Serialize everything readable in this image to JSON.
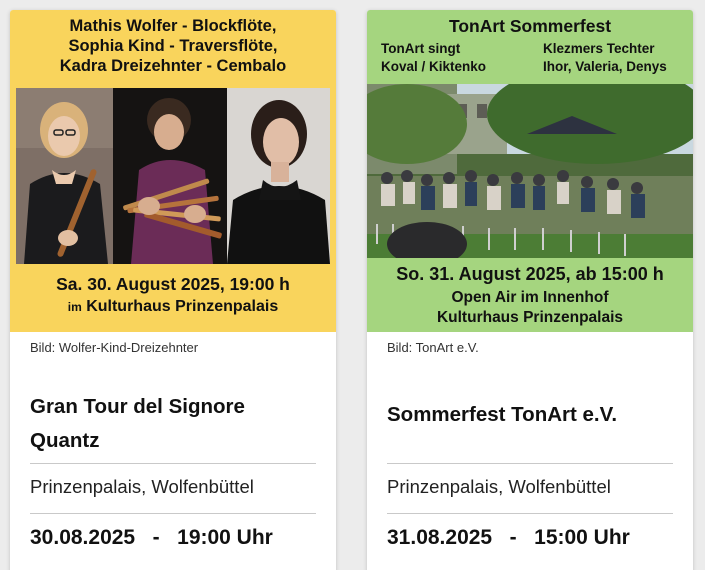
{
  "cards": [
    {
      "poster": {
        "lines": [
          "Mathis Wolfer - Blockflöte,",
          "Sophia Kind - Traversflöte,",
          "Kadra Dreizehnter - Cembalo"
        ],
        "date_line": "Sa. 30. August 2025, 19:00 h",
        "venue_prefix": "im",
        "venue_name": "Kulturhaus Prinzenpalais"
      },
      "credit": "Bild: Wolfer-Kind-Dreizehnter",
      "title": "Gran Tour del Signore Quantz",
      "venue": "Prinzenpalais, Wolfenbüttel",
      "date": "30.08.2025",
      "separator": "-",
      "time": "19:00 Uhr"
    },
    {
      "poster": {
        "title": "TonArt Sommerfest",
        "left_lines": [
          "TonArt singt",
          "Koval / Kiktenko"
        ],
        "right_lines": [
          "Klezmers Techter",
          "Ihor, Valeria, Denys"
        ],
        "date_line": "So. 31. August 2025, ab 15:00 h",
        "line2": "Open Air im Innenhof",
        "line3": "Kulturhaus Prinzenpalais"
      },
      "credit": "Bild: TonArt e.V.",
      "title": "Sommerfest TonArt e.V.",
      "venue": "Prinzenpalais, Wolfenbüttel",
      "date": "31.08.2025",
      "separator": "-",
      "time": "15:00 Uhr"
    }
  ],
  "colors": {
    "poster1_bg": "#f9d45c",
    "poster2_bg": "#a5d57f",
    "card_bg": "#ffffff",
    "page_bg": "#ececec"
  }
}
